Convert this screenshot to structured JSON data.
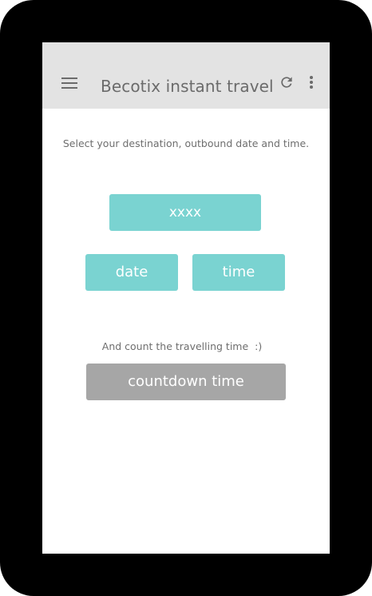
{
  "app_bar": {
    "title": "Becotix instant travel",
    "icons": [
      "menu-icon",
      "refresh-icon",
      "overflow-menu-icon"
    ]
  },
  "main": {
    "instruction": "Select your destination, outbound date and time.",
    "destination_label": "xxxx",
    "date_label": "date",
    "time_label": "time",
    "count_label": "And count the travelling time  :)",
    "countdown_label": "countdown time"
  },
  "colors": {
    "app_bar": "#e3e3e3",
    "accent_teal": "#7ad3d1",
    "countdown_gray": "#a6a6a6",
    "device_frame": "#000000"
  }
}
